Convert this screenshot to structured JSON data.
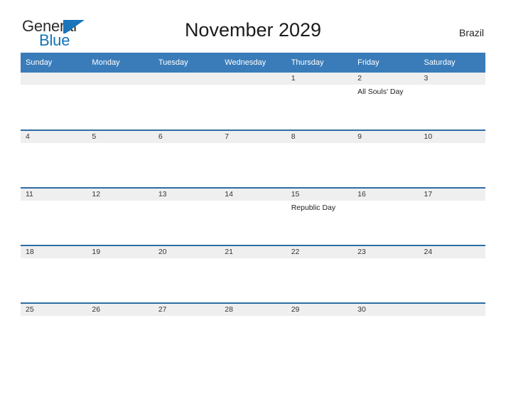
{
  "brand": {
    "name_part1": "General",
    "name_part2": "Blue",
    "icon": "triangle-logo-icon",
    "color_dark": "#2b2b2b",
    "color_blue": "#1273bb"
  },
  "header": {
    "title": "November 2029",
    "country": "Brazil"
  },
  "calendar": {
    "header_bg": "#3a7cb9",
    "row_rule_color": "#2e6da4",
    "date_band_bg": "#efefef",
    "weekdays": [
      "Sunday",
      "Monday",
      "Tuesday",
      "Wednesday",
      "Thursday",
      "Friday",
      "Saturday"
    ],
    "weeks": [
      [
        {
          "date": "",
          "events": []
        },
        {
          "date": "",
          "events": []
        },
        {
          "date": "",
          "events": []
        },
        {
          "date": "",
          "events": []
        },
        {
          "date": "1",
          "events": []
        },
        {
          "date": "2",
          "events": [
            "All Souls' Day"
          ]
        },
        {
          "date": "3",
          "events": []
        }
      ],
      [
        {
          "date": "4",
          "events": []
        },
        {
          "date": "5",
          "events": []
        },
        {
          "date": "6",
          "events": []
        },
        {
          "date": "7",
          "events": []
        },
        {
          "date": "8",
          "events": []
        },
        {
          "date": "9",
          "events": []
        },
        {
          "date": "10",
          "events": []
        }
      ],
      [
        {
          "date": "11",
          "events": []
        },
        {
          "date": "12",
          "events": []
        },
        {
          "date": "13",
          "events": []
        },
        {
          "date": "14",
          "events": []
        },
        {
          "date": "15",
          "events": [
            "Republic Day"
          ]
        },
        {
          "date": "16",
          "events": []
        },
        {
          "date": "17",
          "events": []
        }
      ],
      [
        {
          "date": "18",
          "events": []
        },
        {
          "date": "19",
          "events": []
        },
        {
          "date": "20",
          "events": []
        },
        {
          "date": "21",
          "events": []
        },
        {
          "date": "22",
          "events": []
        },
        {
          "date": "23",
          "events": []
        },
        {
          "date": "24",
          "events": []
        }
      ],
      [
        {
          "date": "25",
          "events": []
        },
        {
          "date": "26",
          "events": []
        },
        {
          "date": "27",
          "events": []
        },
        {
          "date": "28",
          "events": []
        },
        {
          "date": "29",
          "events": []
        },
        {
          "date": "30",
          "events": []
        },
        {
          "date": "",
          "events": []
        }
      ]
    ]
  }
}
